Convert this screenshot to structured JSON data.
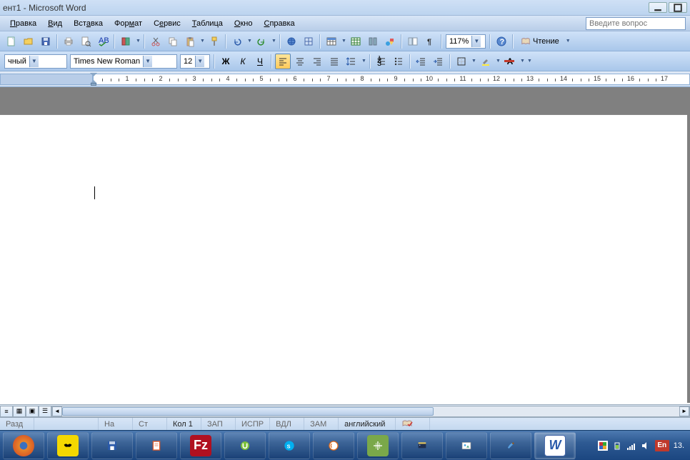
{
  "title": "ент1 - Microsoft Word",
  "menu": [
    "Правка",
    "Вид",
    "Вставка",
    "Формат",
    "Сервис",
    "Таблица",
    "Окно",
    "Справка"
  ],
  "question_placeholder": "Введите вопрос",
  "toolbar1": {
    "zoom": "117%",
    "reading": "Чтение"
  },
  "toolbar2": {
    "style": "чный",
    "font": "Times New Roman",
    "size": "12",
    "bold": "Ж",
    "italic": "К",
    "underline": "Ч",
    "fontA": "A"
  },
  "ruler": {
    "min": 1,
    "max": 17
  },
  "status": {
    "section": "Разд",
    "on": "На",
    "st": "Ст",
    "col": "Кол  1",
    "zap": "ЗАП",
    "ispr": "ИСПР",
    "vdl": "ВДЛ",
    "zam": "ЗАМ",
    "lang": "английский"
  },
  "tray": {
    "lang": "En",
    "date": "13."
  }
}
